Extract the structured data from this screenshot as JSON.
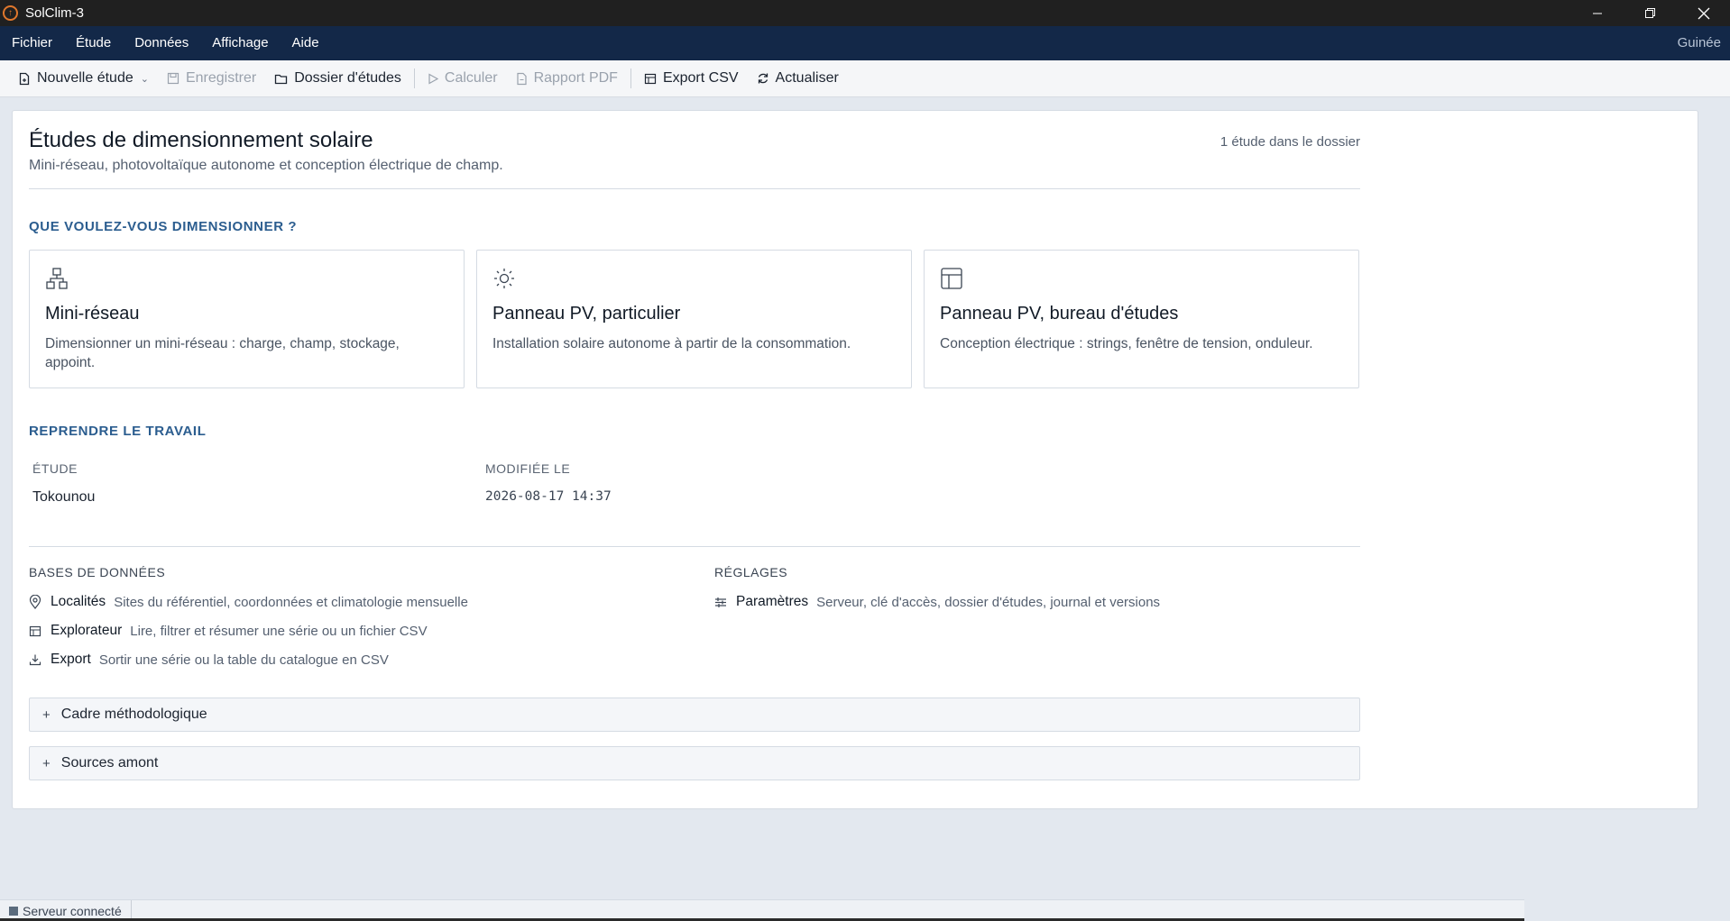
{
  "window": {
    "title": "SolClim-3",
    "app_icon": "sun-power-icon"
  },
  "menubar": {
    "items": [
      "Fichier",
      "Étude",
      "Données",
      "Affichage",
      "Aide"
    ],
    "right_label": "Guinée"
  },
  "toolbar": {
    "buttons": [
      {
        "label": "Nouvelle étude",
        "icon": "new-file-icon",
        "enabled": true
      },
      {
        "label": "Enregistrer",
        "icon": "save-icon",
        "enabled": false
      },
      {
        "label": "Dossier d'études",
        "icon": "folder-icon",
        "enabled": true
      },
      {
        "label": "Calculer",
        "icon": "play-icon",
        "enabled": false
      },
      {
        "label": "Rapport PDF",
        "icon": "pdf-icon",
        "enabled": false
      },
      {
        "label": "Export CSV",
        "icon": "table-icon",
        "enabled": true
      },
      {
        "label": "Actualiser",
        "icon": "refresh-icon",
        "enabled": true
      }
    ]
  },
  "header": {
    "title": "Études de dimensionnement solaire",
    "subtitle": "Mini-réseau, photovoltaïque autonome et conception électrique de champ.",
    "count": "1 étude dans le dossier"
  },
  "dimension": {
    "section_title": "QUE VOULEZ-VOUS DIMENSIONNER ?",
    "cards": [
      {
        "title": "Mini-réseau",
        "desc": "Dimensionner un mini-réseau : charge, champ, stockage, appoint.",
        "icon": "network-icon"
      },
      {
        "title": "Panneau PV, particulier",
        "desc": "Installation solaire autonome à partir de la consommation.",
        "icon": "sun-icon"
      },
      {
        "title": "Panneau PV, bureau d'études",
        "desc": "Conception électrique : strings, fenêtre de tension, onduleur.",
        "icon": "layout-icon"
      }
    ]
  },
  "resume": {
    "section_title": "REPRENDRE LE TRAVAIL",
    "col_study": "ÉTUDE",
    "col_modified": "MODIFIÉE LE",
    "rows": [
      {
        "study": "Tokounou",
        "modified": "2026-08-17 14:37"
      }
    ]
  },
  "databases": {
    "title": "BASES DE DONNÉES",
    "links": [
      {
        "name": "Localités",
        "desc": "Sites du référentiel, coordonnées et climatologie mensuelle",
        "icon": "location-pin-icon"
      },
      {
        "name": "Explorateur",
        "desc": "Lire, filtrer et résumer une série ou un fichier CSV",
        "icon": "table-icon"
      },
      {
        "name": "Export",
        "desc": "Sortir une série ou la table du catalogue en CSV",
        "icon": "download-icon"
      }
    ]
  },
  "settings": {
    "title": "RÉGLAGES",
    "links": [
      {
        "name": "Paramètres",
        "desc": "Serveur, clé d'accès, dossier d'études, journal et versions",
        "icon": "sliders-icon"
      }
    ]
  },
  "collapsibles": [
    {
      "label": "Cadre méthodologique",
      "marker": "+"
    },
    {
      "label": "Sources amont",
      "marker": "+"
    }
  ],
  "status": {
    "text": "Serveur connecté"
  },
  "colors": {
    "menubar_bg": "#132848",
    "section_title": "#2b5d8f",
    "titlebar_bg": "#202020",
    "app_icon": "#e0772c"
  }
}
